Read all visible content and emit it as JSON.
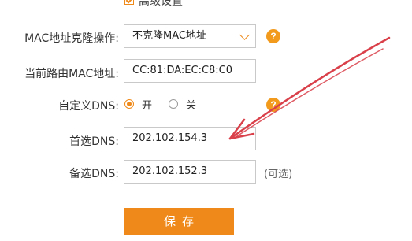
{
  "advanced": {
    "checkbox_label": "高级设置",
    "checked": true
  },
  "mac_clone": {
    "label": "MAC地址克隆操作:",
    "selected": "不克隆MAC地址"
  },
  "router_mac": {
    "label": "当前路由MAC地址:",
    "value": "CC:81:DA:EC:C8:C0"
  },
  "custom_dns": {
    "label": "自定义DNS:",
    "on_label": "开",
    "off_label": "关",
    "selected": "on"
  },
  "primary_dns": {
    "label": "首选DNS:",
    "value": "202.102.154.3"
  },
  "secondary_dns": {
    "label": "备选DNS:",
    "value": "202.102.152.3",
    "hint": "(可选)"
  },
  "help_icon_text": "?",
  "save_button_label": "保存",
  "colors": {
    "accent": "#ef8a1a",
    "annotation_arrow": "#d9404a"
  },
  "icons": [
    "checkbox-checked-icon",
    "chevron-down-icon",
    "help-icon",
    "radio-icon",
    "annotation-arrow-icon"
  ]
}
